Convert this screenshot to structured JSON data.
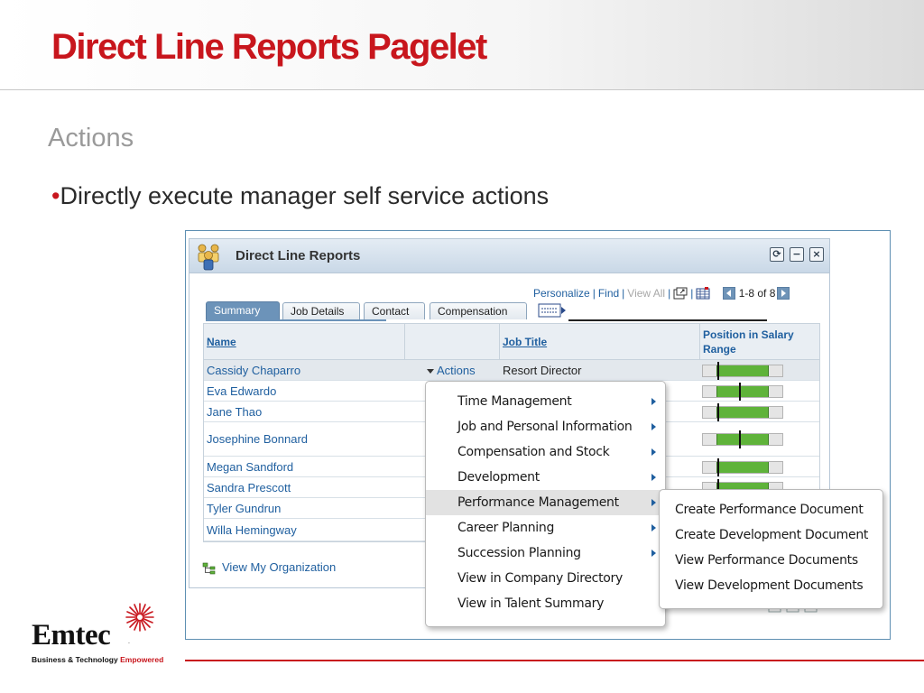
{
  "slide": {
    "title": "Direct Line Reports Pagelet",
    "subtitle": "Actions",
    "bullet_marker": "•",
    "bullet": "Directly execute manager self service actions"
  },
  "pagelet": {
    "title": "Direct Line Reports",
    "header_buttons": [
      "refresh-icon",
      "minimize-icon",
      "close-icon"
    ],
    "toolbar": {
      "personalize": "Personalize",
      "find": "Find",
      "view_all": "View All",
      "separator": "|",
      "count": "1-8 of 8"
    },
    "tabs": [
      "Summary",
      "Job Details",
      "Contact",
      "Compensation"
    ],
    "active_tab": "Summary",
    "columns": {
      "name": "Name",
      "job_title": "Job Title",
      "position_in_salary_range": "Position in Salary Range"
    },
    "actions_label": "Actions",
    "rows": [
      {
        "name": "Cassidy Chaparro",
        "job_title": "Resort Director",
        "salary_position": 0.18
      },
      {
        "name": "Eva Edwardo",
        "job_title": "",
        "salary_position": 0.45
      },
      {
        "name": "Jane Thao",
        "job_title": "",
        "salary_position": 0.18
      },
      {
        "name": "Josephine Bonnard",
        "job_title": "",
        "salary_position": 0.45
      },
      {
        "name": "Megan Sandford",
        "job_title": "",
        "salary_position": 0.18
      },
      {
        "name": "Sandra Prescott",
        "job_title": "",
        "salary_position": 0.18
      },
      {
        "name": "Tyler Gundrun",
        "job_title": "",
        "salary_position": 0.18
      },
      {
        "name": "Willa Hemingway",
        "job_title": "",
        "salary_position": 0.18
      }
    ],
    "view_org_link": "View My Organization"
  },
  "actions_menu": {
    "items": [
      {
        "label": "Time Management",
        "has_submenu": true
      },
      {
        "label": "Job and Personal Information",
        "has_submenu": true
      },
      {
        "label": "Compensation and Stock",
        "has_submenu": true
      },
      {
        "label": "Development",
        "has_submenu": true
      },
      {
        "label": "Performance Management",
        "has_submenu": true,
        "highlighted": true
      },
      {
        "label": "Career Planning",
        "has_submenu": true
      },
      {
        "label": "Succession Planning",
        "has_submenu": true
      },
      {
        "label": "View in Company Directory",
        "has_submenu": false
      },
      {
        "label": "View in Talent Summary",
        "has_submenu": false
      }
    ]
  },
  "performance_submenu": {
    "items": [
      "Create Performance Document",
      "Create Development Document",
      "View Performance Documents",
      "View Development Documents"
    ]
  },
  "footer": {
    "logo_text": "Emtec",
    "logo_reg": ".",
    "tagline_main": "Business & Technology ",
    "tagline_accent": "Empowered"
  },
  "colors": {
    "title_red": "#c8161d",
    "link_blue": "#1f5f9f",
    "tab_active": "#6c93b9",
    "salary_green": "#5fb33a"
  }
}
